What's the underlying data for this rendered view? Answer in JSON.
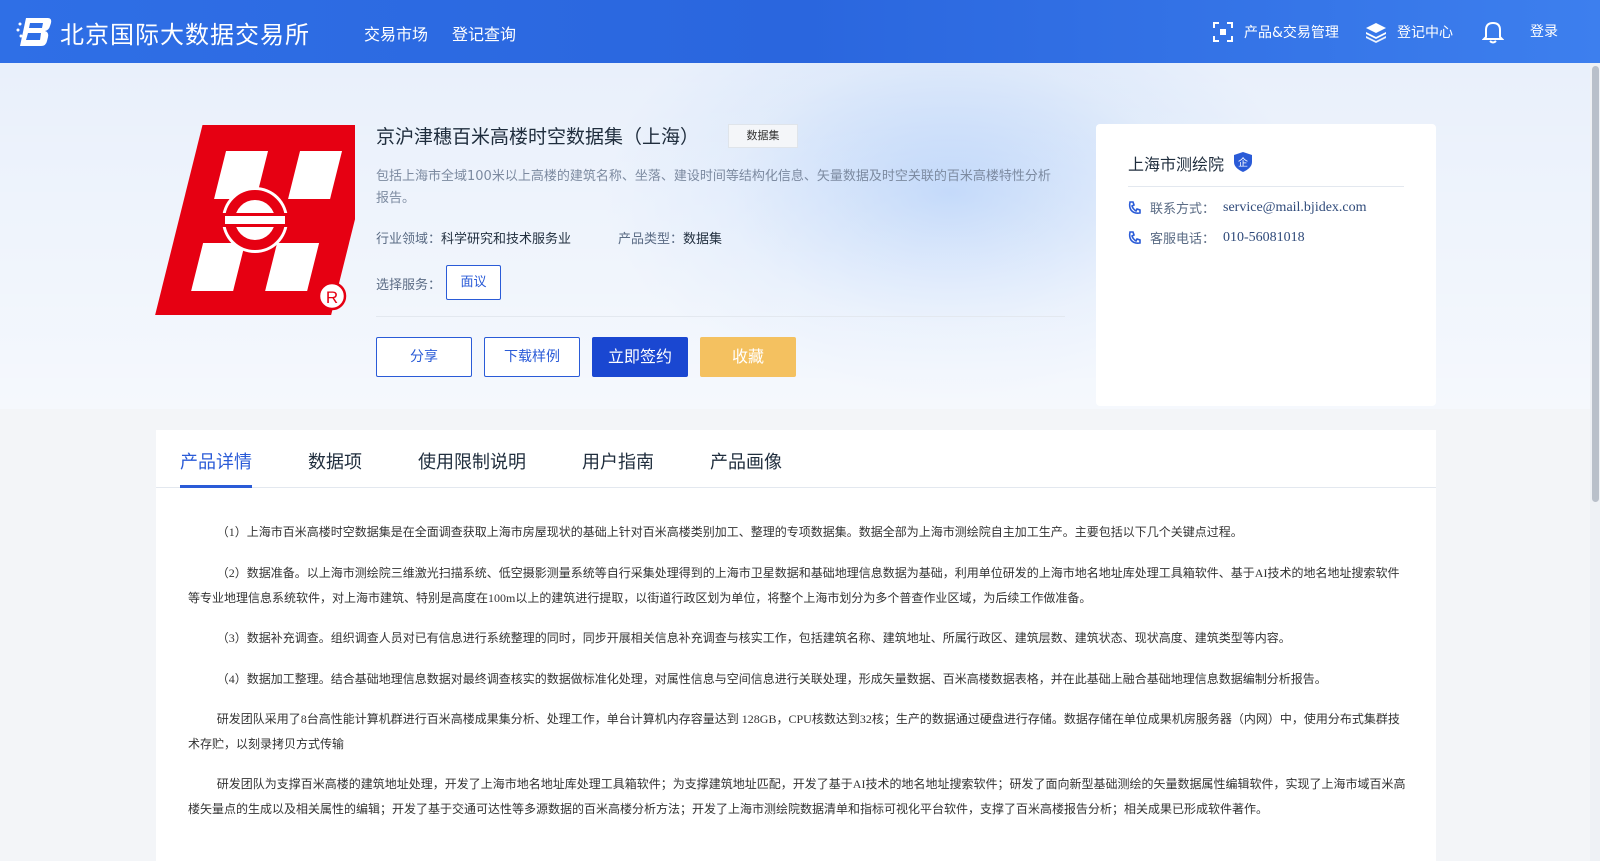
{
  "header": {
    "brand": "北京国际大数据交易所",
    "nav": [
      "交易市场",
      "登记查询"
    ],
    "product_mgmt": "产品&交易管理",
    "registry_center": "登记中心",
    "login": "登录"
  },
  "product": {
    "title": "京沪津穗百米高楼时空数据集（上海）",
    "badge": "数据集",
    "description": "包括上海市全域100米以上高楼的建筑名称、坐落、建设时间等结构化信息、矢量数据及时空关联的百米高楼特性分析报告。",
    "industry_label": "行业领域：",
    "industry": "科学研究和技术服务业",
    "type_label": "产品类型：",
    "type": "数据集",
    "service_label": "选择服务：",
    "service_option": "面议"
  },
  "actions": {
    "share": "分享",
    "download": "下载样例",
    "sign": "立即签约",
    "favorite": "收藏"
  },
  "provider": {
    "name": "上海市测绘院",
    "badge_text": "企",
    "contact_label": "联系方式：",
    "contact": "service@mail.bjidex.com",
    "phone_label": "客服电话：",
    "phone": "010-56081018"
  },
  "tabs": [
    "产品详情",
    "数据项",
    "使用限制说明",
    "用户指南",
    "产品画像"
  ],
  "details": [
    "（1）上海市百米高楼时空数据集是在全面调查获取上海市房屋现状的基础上针对百米高楼类别加工、整理的专项数据集。数据全部为上海市测绘院自主加工生产。主要包括以下几个关键点过程。",
    "（2）数据准备。以上海市测绘院三维激光扫描系统、低空摄影测量系统等自行采集处理得到的上海市卫星数据和基础地理信息数据为基础，利用单位研发的上海市地名地址库处理工具箱软件、基于AI技术的地名地址搜索软件等专业地理信息系统软件，对上海市建筑、特别是高度在100m以上的建筑进行提取，以街道行政区划为单位，将整个上海市划分为多个普查作业区域，为后续工作做准备。",
    "（3）数据补充调查。组织调查人员对已有信息进行系统整理的同时，同步开展相关信息补充调查与核实工作，包括建筑名称、建筑地址、所属行政区、建筑层数、建筑状态、现状高度、建筑类型等内容。",
    "（4）数据加工整理。结合基础地理信息数据对最终调查核实的数据做标准化处理，对属性信息与空间信息进行关联处理，形成矢量数据、百米高楼数据表格，并在此基础上融合基础地理信息数据编制分析报告。",
    "研发团队采用了8台高性能计算机群进行百米高楼成果集分析、处理工作，单台计算机内存容量达到 128GB，CPU核数达到32核；生产的数据通过硬盘进行存储。数据存储在单位成果机房服务器（内网）中，使用分布式集群技术存贮，以刻录拷贝方式传输",
    "研发团队为支撑百米高楼的建筑地址处理，开发了上海市地名地址库处理工具箱软件；为支撑建筑地址匹配，开发了基于AI技术的地名地址搜索软件；研发了面向新型基础测绘的矢量数据属性编辑软件，实现了上海市域百米高楼矢量点的生成以及相关属性的编辑；开发了基于交通可达性等多源数据的百米高楼分析方法；开发了上海市测绘院数据清单和指标可视化平台软件，支撑了百米高楼报告分析；相关成果已形成软件著作。"
  ],
  "colors": {
    "header": "#2f6fe6",
    "primary": "#1a47d1",
    "accent_yellow": "#f4c160",
    "logo_red": "#e60012"
  }
}
